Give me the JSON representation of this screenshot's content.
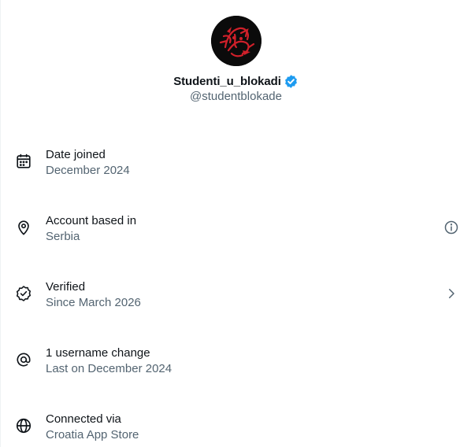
{
  "profile": {
    "display_name": "Studenti_u_blokadi",
    "handle": "@studentblokade",
    "verified": true,
    "verified_badge_color": "#1d9bf0"
  },
  "about": [
    {
      "icon": "calendar-icon",
      "label": "Date joined",
      "value": "December 2024"
    },
    {
      "icon": "location-pin-icon",
      "label": "Account based in",
      "value": "Serbia",
      "action_icon": "info-icon"
    },
    {
      "icon": "verified-badge-outline-icon",
      "label": "Verified",
      "value": "Since March 2026",
      "action_icon": "chevron-right-icon"
    },
    {
      "icon": "at-sign-icon",
      "label": "1 username change",
      "value": "Last on December 2024"
    },
    {
      "icon": "globe-icon",
      "label": "Connected via",
      "value": "Croatia App Store"
    }
  ],
  "colors": {
    "primary_text": "#0f1419",
    "secondary_text": "#536471",
    "avatar_art": "#d0202a"
  }
}
